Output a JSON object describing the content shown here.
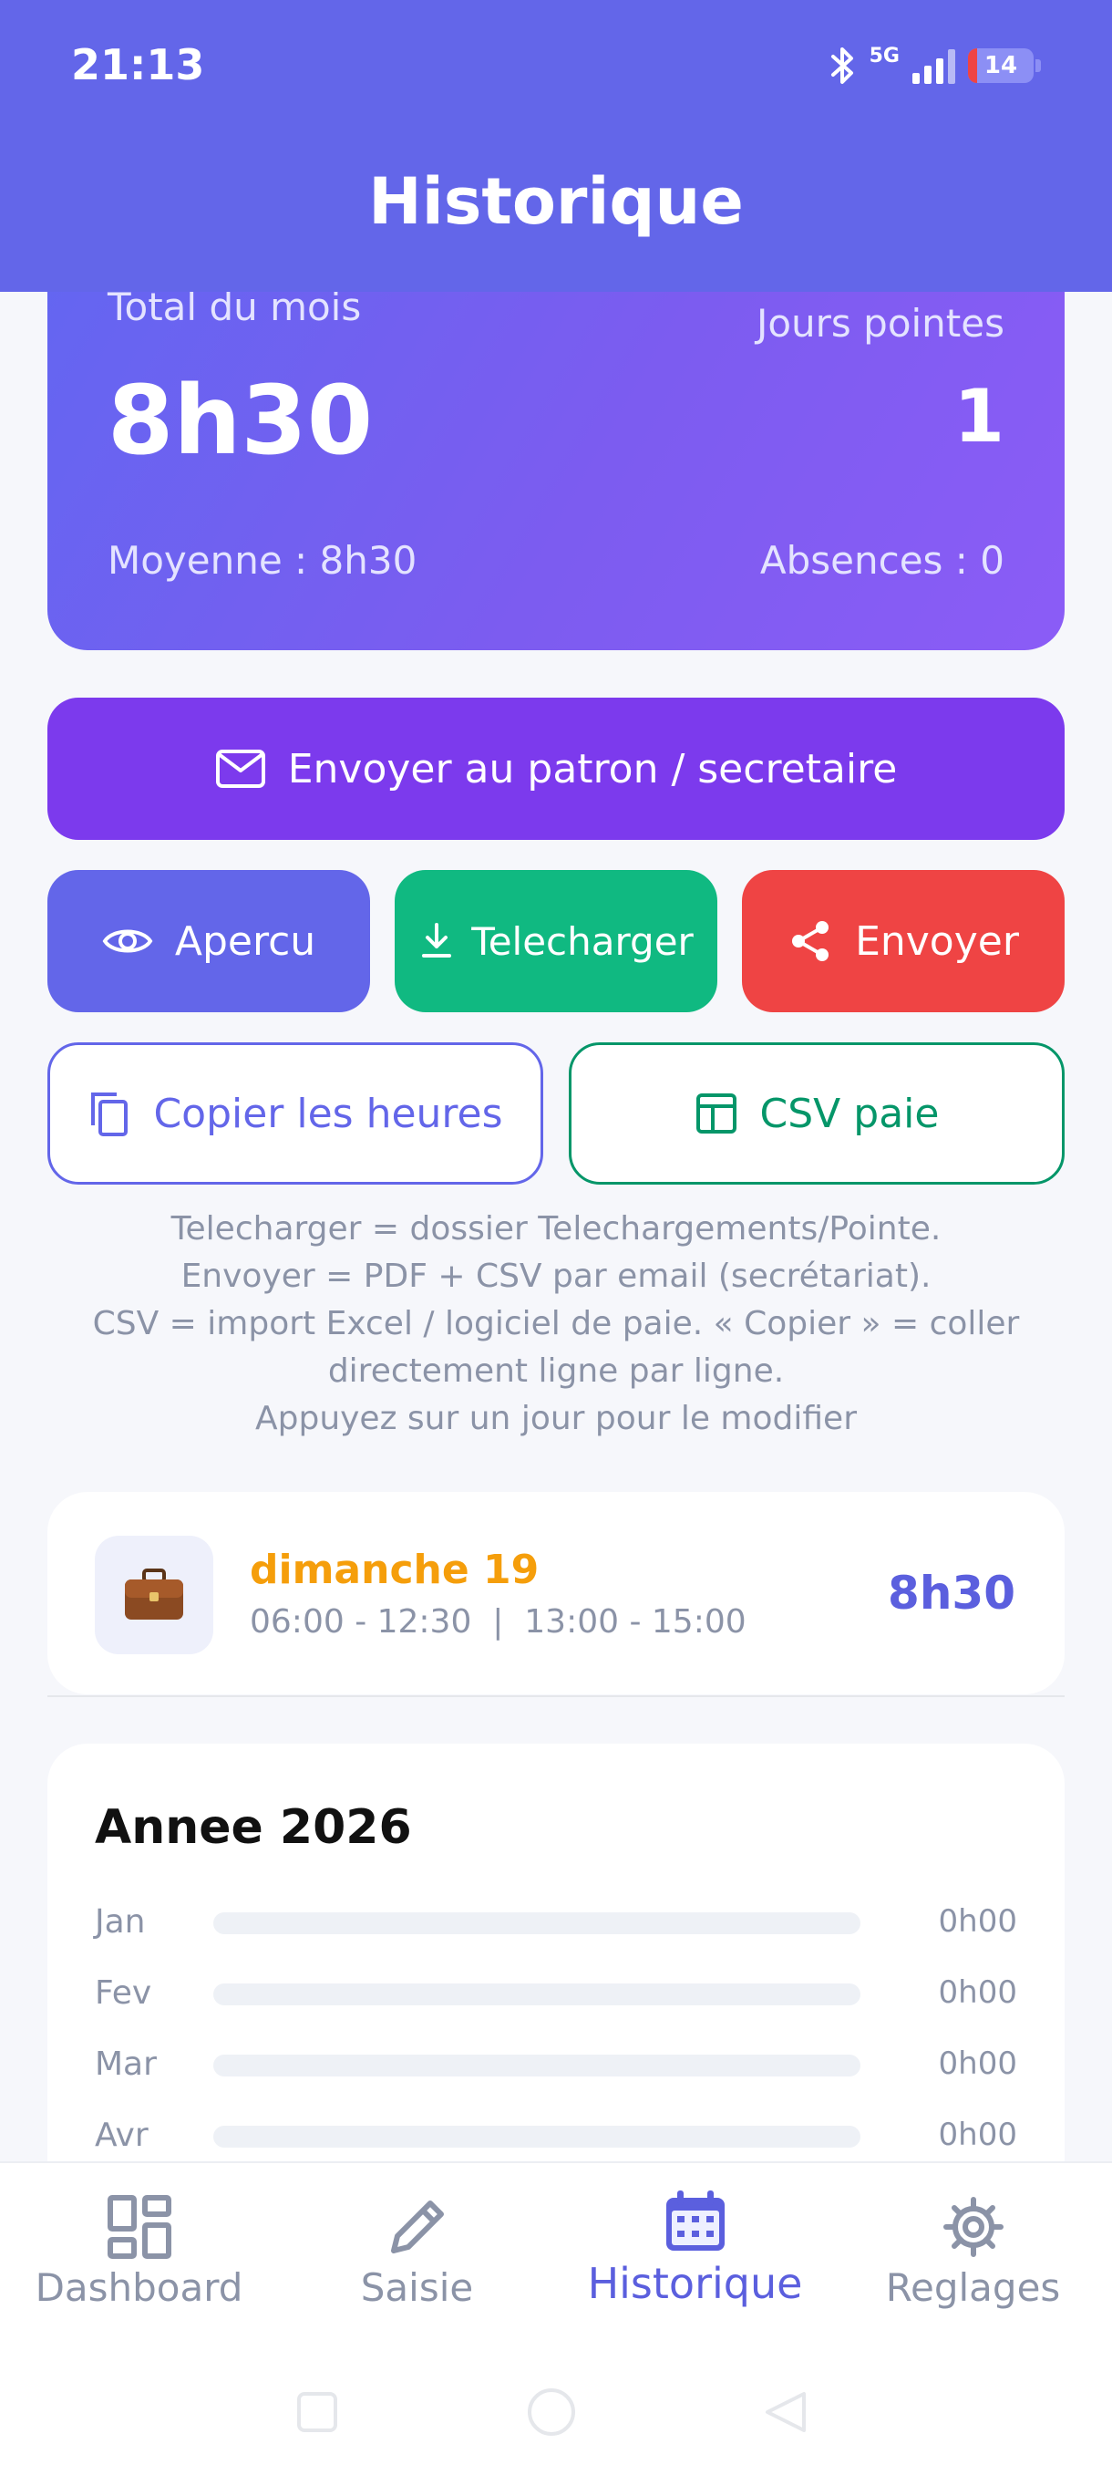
{
  "status_bar": {
    "time": "21:13",
    "network": "5G",
    "battery": "14"
  },
  "header": {
    "title": "Historique"
  },
  "summary": {
    "total_label": "Total du mois",
    "total_value": "8h30",
    "days_label": "Jours pointes",
    "days_value": "1",
    "average": "Moyenne : 8h30",
    "absences": "Absences : 0"
  },
  "actions": {
    "send_boss": "Envoyer au patron / secretaire",
    "preview": "Apercu",
    "download": "Telecharger",
    "send": "Envoyer",
    "copy_hours": "Copier les heures",
    "csv": "CSV paie"
  },
  "hint_lines": [
    "Telecharger = dossier Telechargements/Pointe.",
    "Envoyer = PDF + CSV par email (secrétariat).",
    "CSV = import Excel / logiciel de paie. « Copier » = coller",
    "directement ligne par ligne.",
    "Appuyez sur un jour pour le modifier"
  ],
  "days": [
    {
      "name": "dimanche 19",
      "times": "06:00 - 12:30  |  13:00 - 15:00",
      "total": "8h30",
      "icon": "briefcase-icon"
    }
  ],
  "year": {
    "title": "Annee 2026",
    "months": [
      {
        "label": "Jan",
        "value": "0h00",
        "fill": 0
      },
      {
        "label": "Fev",
        "value": "0h00",
        "fill": 0
      },
      {
        "label": "Mar",
        "value": "0h00",
        "fill": 0
      },
      {
        "label": "Avr",
        "value": "0h00",
        "fill": 0
      }
    ]
  },
  "nav": [
    {
      "label": "Dashboard",
      "icon": "dashboard-icon",
      "active": false
    },
    {
      "label": "Saisie",
      "icon": "pencil-icon",
      "active": false
    },
    {
      "label": "Historique",
      "icon": "calendar-icon",
      "active": true
    },
    {
      "label": "Reglages",
      "icon": "gear-icon",
      "active": false
    }
  ],
  "colors": {
    "primary": "#6366e9",
    "purple": "#7c3aed",
    "green": "#10b981",
    "red": "#ef4444",
    "orange": "#f59e0b"
  }
}
